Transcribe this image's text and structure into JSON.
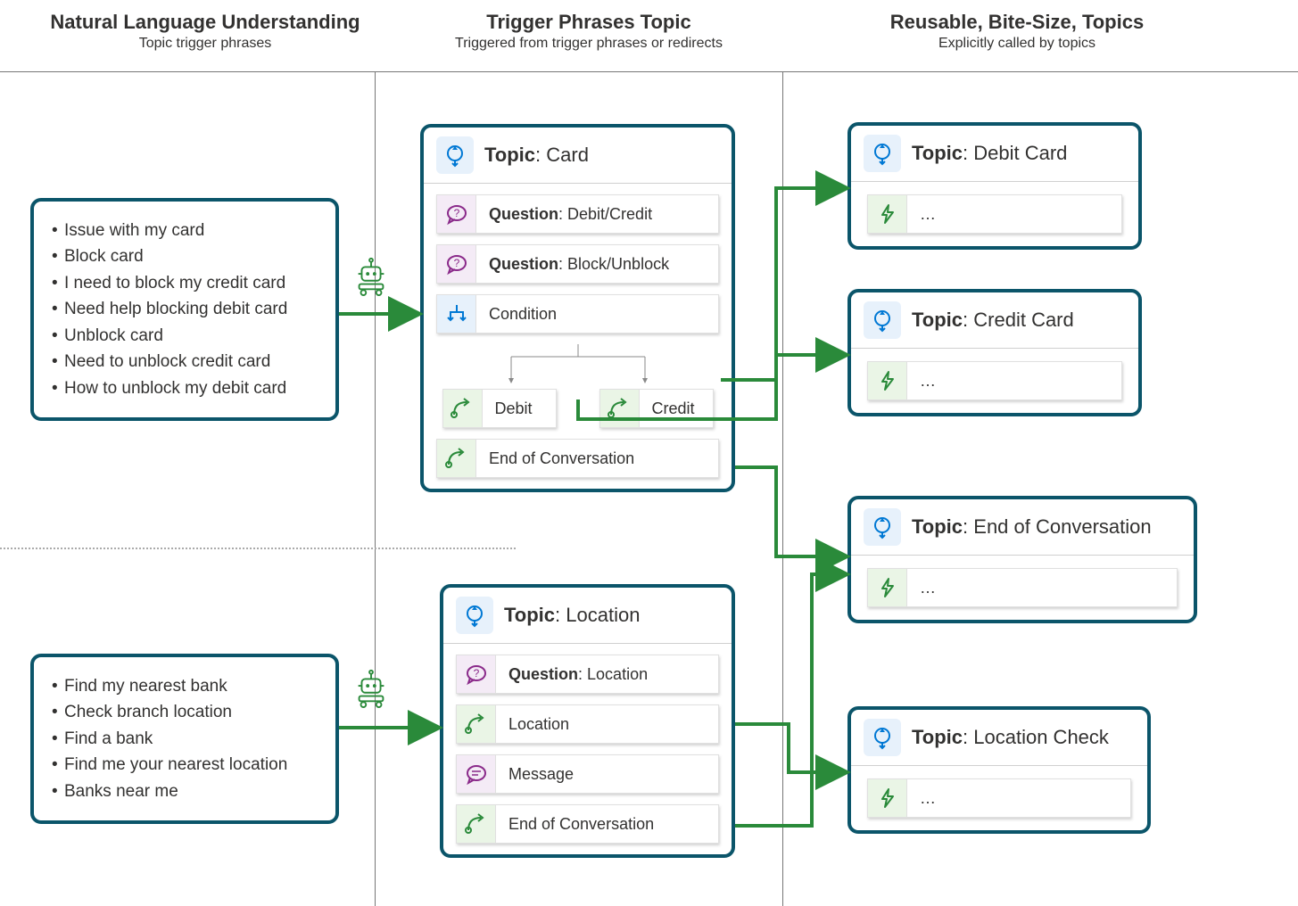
{
  "columns": {
    "c1": {
      "title": "Natural Language Understanding",
      "subtitle": "Topic trigger phrases"
    },
    "c2": {
      "title": "Trigger Phrases Topic",
      "subtitle": "Triggered from trigger phrases or redirects"
    },
    "c3": {
      "title": "Reusable, Bite-Size, Topics",
      "subtitle": "Explicitly called by topics"
    }
  },
  "phrases1": [
    "Issue with my card",
    "Block card",
    "I need to block my credit card",
    "Need help blocking debit card",
    "Unblock card",
    "Need to unblock credit card",
    "How to unblock my debit card"
  ],
  "phrases2": [
    "Find my nearest bank",
    "Check branch location",
    "Find a bank",
    "Find me your nearest location",
    "Banks near me"
  ],
  "topicCard": {
    "title_prefix": "Topic",
    "title": "Card",
    "q1_prefix": "Question",
    "q1": "Debit/Credit",
    "q2_prefix": "Question",
    "q2": "Block/Unblock",
    "cond": "Condition",
    "branch_a": "Debit",
    "branch_b": "Credit",
    "eoc": "End of Conversation"
  },
  "topicLocation": {
    "title_prefix": "Topic",
    "title": "Location",
    "q1_prefix": "Question",
    "q1": "Location",
    "r1": "Location",
    "msg": "Message",
    "eoc": "End of Conversation"
  },
  "rightTopics": {
    "t1": {
      "prefix": "Topic",
      "name": "Debit Card",
      "body": "…"
    },
    "t2": {
      "prefix": "Topic",
      "name": "Credit Card",
      "body": "…"
    },
    "t3": {
      "prefix": "Topic",
      "name": "End of Conversation",
      "body": "…"
    },
    "t4": {
      "prefix": "Topic",
      "name": "Location Check",
      "body": "…"
    }
  }
}
